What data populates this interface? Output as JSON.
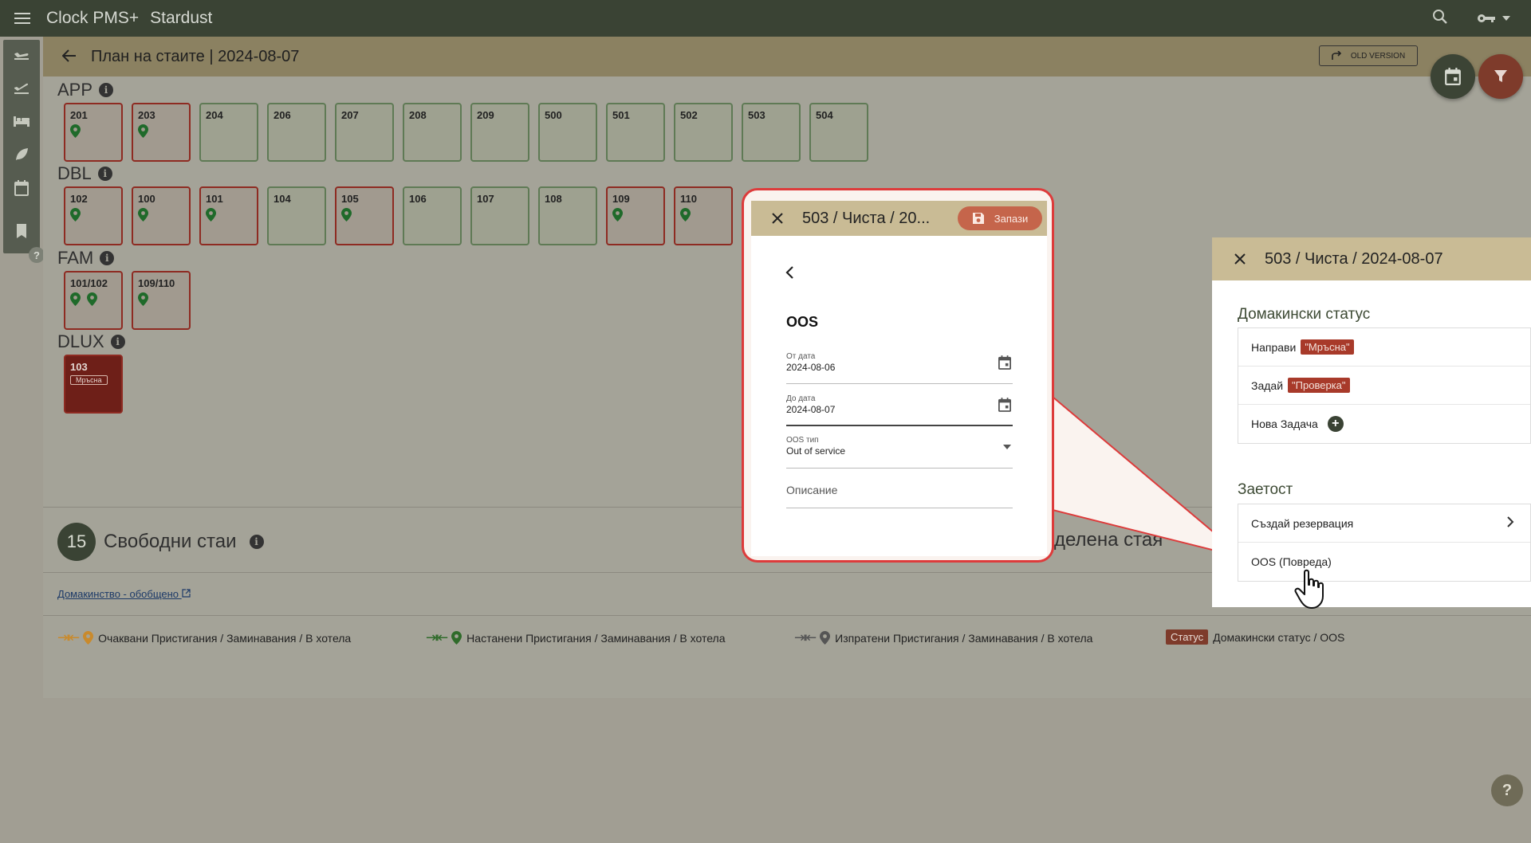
{
  "app": {
    "title": "Clock PMS+",
    "hotel": "Stardust"
  },
  "page": {
    "title": "План на стаите | 2024-08-07",
    "old_version_label": "OLD VERSION"
  },
  "groups": [
    {
      "name": "APP",
      "rooms": [
        {
          "no": "201",
          "state": "red",
          "pins": 1
        },
        {
          "no": "203",
          "state": "red",
          "pins": 1
        },
        {
          "no": "204",
          "state": "green",
          "pins": 0
        },
        {
          "no": "206",
          "state": "green",
          "pins": 0
        },
        {
          "no": "207",
          "state": "green",
          "pins": 0
        },
        {
          "no": "208",
          "state": "green",
          "pins": 0
        },
        {
          "no": "209",
          "state": "green",
          "pins": 0
        },
        {
          "no": "500",
          "state": "green",
          "pins": 0
        },
        {
          "no": "501",
          "state": "green",
          "pins": 0
        },
        {
          "no": "502",
          "state": "green",
          "pins": 0
        },
        {
          "no": "503",
          "state": "green",
          "pins": 0
        },
        {
          "no": "504",
          "state": "green",
          "pins": 0
        }
      ]
    },
    {
      "name": "DBL",
      "rooms": [
        {
          "no": "102",
          "state": "red",
          "pins": 1
        },
        {
          "no": "100",
          "state": "red",
          "pins": 1
        },
        {
          "no": "101",
          "state": "red",
          "pins": 1
        },
        {
          "no": "104",
          "state": "green",
          "pins": 0
        },
        {
          "no": "105",
          "state": "red",
          "pins": 1
        },
        {
          "no": "106",
          "state": "green",
          "pins": 0
        },
        {
          "no": "107",
          "state": "green",
          "pins": 0
        },
        {
          "no": "108",
          "state": "green",
          "pins": 0
        },
        {
          "no": "109",
          "state": "red",
          "pins": 1
        },
        {
          "no": "110",
          "state": "red",
          "pins": 1
        }
      ]
    },
    {
      "name": "FAM",
      "rooms": [
        {
          "no": "101/102",
          "state": "red",
          "pins": 2
        },
        {
          "no": "109/110",
          "state": "red",
          "pins": 1
        }
      ]
    },
    {
      "name": "DLUX",
      "rooms": [
        {
          "no": "103",
          "state": "dirty",
          "pins": 0,
          "badge": "Мръсна"
        }
      ]
    }
  ],
  "free_rooms": {
    "count": "15",
    "label": "Свободни стаи"
  },
  "assigned_room_label": "делена стая",
  "housekeeping_link": "Домакинство - обобщено",
  "legend": [
    {
      "text": "Очаквани Пристигания / Заминавания / В хотела",
      "color": "#c98a2c"
    },
    {
      "text": "Настанени Пристигания / Заминавания / В хотела",
      "color": "#2f6b2a"
    },
    {
      "text": "Изпратени Пристигания / Заминавания / В хотела",
      "color": "#555555"
    },
    {
      "chip": "Статус",
      "text": "Домакински статус / OOS"
    }
  ],
  "zoom_panel": {
    "title": "503 / Чиста / 20...",
    "save_label": "Запази",
    "type_label": "OOS",
    "from": {
      "label": "От дата",
      "value": "2024-08-06"
    },
    "to": {
      "label": "До дата",
      "value": "2024-08-07"
    },
    "oos_type": {
      "label": "OOS тип",
      "value": "Out of service"
    },
    "description_placeholder": "Описание"
  },
  "side_panel": {
    "title": "503 / Чиста / 2024-08-07",
    "hk_section": "Домакински статус",
    "make_label": "Направи",
    "make_tag": "\"Мръсна\"",
    "set_label": "Задай",
    "set_tag": "\"Проверка\"",
    "new_task_label": "Нова Задача",
    "occupancy_section": "Заетост",
    "create_reservation": "Създай резервация",
    "oos_damage": "OOS (Повреда)"
  },
  "colors": {
    "appbar": "#3a4334",
    "accent": "#7e3b2b",
    "callout": "#dd3b3b"
  }
}
